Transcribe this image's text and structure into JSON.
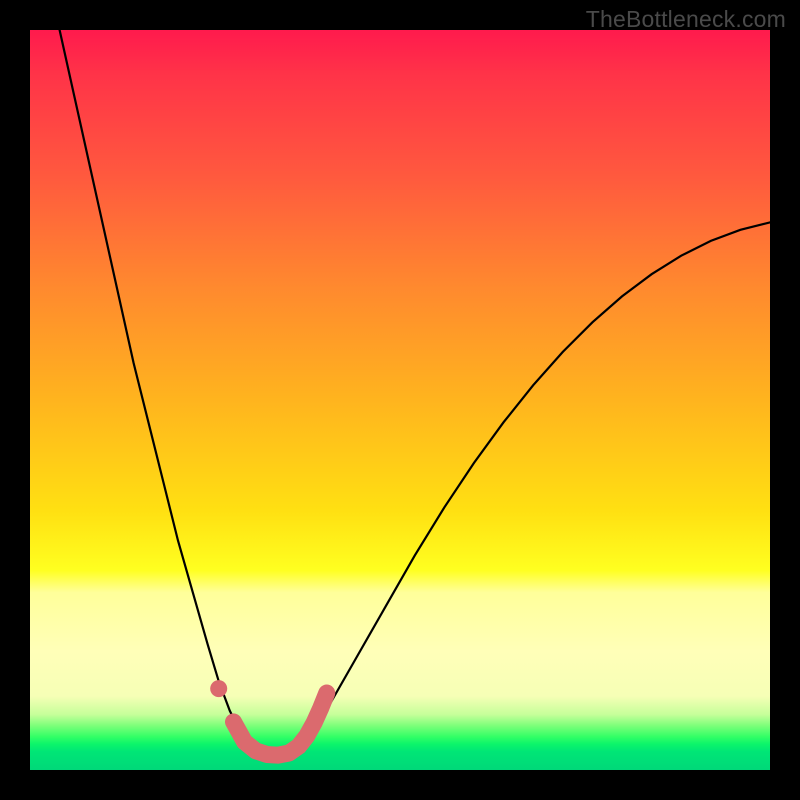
{
  "watermark": {
    "text": "TheBottleneck.com"
  },
  "colors": {
    "background": "#000000",
    "curve_stroke": "#000000",
    "marker_stroke": "#db6a6e",
    "marker_fill": "#db6a6e"
  },
  "chart_data": {
    "type": "line",
    "title": "",
    "xlabel": "",
    "ylabel": "",
    "xlim": [
      0,
      100
    ],
    "ylim": [
      0,
      100
    ],
    "series": [
      {
        "name": "bottleneck-curve",
        "x": [
          4,
          6,
          8,
          10,
          12,
          14,
          16,
          18,
          20,
          22,
          24,
          25.5,
          27,
          28.5,
          30,
          31,
          32,
          33,
          34,
          35,
          36,
          38,
          40,
          44,
          48,
          52,
          56,
          60,
          64,
          68,
          72,
          76,
          80,
          84,
          88,
          92,
          96,
          100
        ],
        "y": [
          100,
          91,
          82,
          73,
          64,
          55,
          47,
          39,
          31,
          24,
          17,
          12,
          8,
          5,
          3,
          2.2,
          2,
          2,
          2.1,
          2.4,
          3,
          5,
          8,
          15,
          22,
          29,
          35.5,
          41.5,
          47,
          52,
          56.5,
          60.5,
          64,
          67,
          69.5,
          71.5,
          73,
          74
        ]
      }
    ],
    "markers": {
      "name": "highlight-floor",
      "dot": {
        "x": 25.5,
        "y": 11
      },
      "segment": [
        {
          "x": 27.5,
          "y": 6.5
        },
        {
          "x": 29,
          "y": 3.8
        },
        {
          "x": 30.5,
          "y": 2.6
        },
        {
          "x": 32,
          "y": 2.1
        },
        {
          "x": 33.5,
          "y": 2.0
        },
        {
          "x": 35,
          "y": 2.3
        },
        {
          "x": 36.3,
          "y": 3.2
        },
        {
          "x": 37.4,
          "y": 4.6
        },
        {
          "x": 38.4,
          "y": 6.4
        },
        {
          "x": 39.3,
          "y": 8.4
        },
        {
          "x": 40.1,
          "y": 10.4
        }
      ]
    }
  }
}
